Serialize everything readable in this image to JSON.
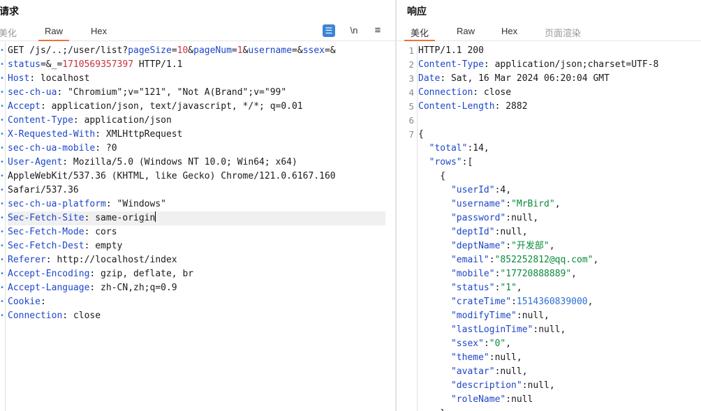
{
  "request": {
    "title": "请求",
    "tabs": {
      "pretty": "美化",
      "raw": "Raw",
      "hex": "Hex"
    },
    "icons": {
      "wrap": "wrap-lines-icon",
      "newline": "\\n",
      "menu": "≡"
    },
    "lines": [
      {
        "parts": [
          {
            "t": "GET /js/..;/user/list?"
          },
          {
            "t": "pageSize",
            "c": "p"
          },
          {
            "t": "="
          },
          {
            "t": "10",
            "c": "v"
          },
          {
            "t": "&"
          },
          {
            "t": "pageNum",
            "c": "p"
          },
          {
            "t": "="
          },
          {
            "t": "1",
            "c": "v"
          },
          {
            "t": "&"
          },
          {
            "t": "username",
            "c": "p"
          },
          {
            "t": "=&"
          },
          {
            "t": "ssex",
            "c": "p"
          },
          {
            "t": "=&"
          }
        ]
      },
      {
        "parts": [
          {
            "t": "status",
            "c": "p"
          },
          {
            "t": "=&_="
          },
          {
            "t": "1710569357397",
            "c": "v"
          },
          {
            "t": " HTTP/1.1"
          }
        ]
      },
      {
        "parts": [
          {
            "t": "Host",
            "c": "k"
          },
          {
            "t": ": localhost"
          }
        ]
      },
      {
        "parts": [
          {
            "t": "sec-ch-ua",
            "c": "k"
          },
          {
            "t": ": \"Chromium\";v=\"121\", \"Not A(Brand\";v=\"99\""
          }
        ]
      },
      {
        "parts": [
          {
            "t": "Accept",
            "c": "k"
          },
          {
            "t": ": application/json, text/javascript, */*; q=0.01"
          }
        ]
      },
      {
        "parts": [
          {
            "t": "Content-Type",
            "c": "k"
          },
          {
            "t": ": application/json"
          }
        ]
      },
      {
        "parts": [
          {
            "t": "X-Requested-With",
            "c": "k"
          },
          {
            "t": ": XMLHttpRequest"
          }
        ]
      },
      {
        "parts": [
          {
            "t": "sec-ch-ua-mobile",
            "c": "k"
          },
          {
            "t": ": ?0"
          }
        ]
      },
      {
        "parts": [
          {
            "t": "User-Agent",
            "c": "k"
          },
          {
            "t": ": Mozilla/5.0 (Windows NT 10.0; Win64; x64)"
          }
        ]
      },
      {
        "parts": [
          {
            "t": "AppleWebKit/537.36 (KHTML, like Gecko) Chrome/121.0.6167.160"
          }
        ]
      },
      {
        "parts": [
          {
            "t": "Safari/537.36"
          }
        ]
      },
      {
        "parts": [
          {
            "t": "sec-ch-ua-platform",
            "c": "k"
          },
          {
            "t": ": \"Windows\""
          }
        ]
      },
      {
        "parts": [
          {
            "t": "Sec-Fetch-Site",
            "c": "k"
          },
          {
            "t": ": same-origin"
          }
        ],
        "highlight": true,
        "caret": true
      },
      {
        "parts": [
          {
            "t": "Sec-Fetch-Mode",
            "c": "k"
          },
          {
            "t": ": cors"
          }
        ]
      },
      {
        "parts": [
          {
            "t": "Sec-Fetch-Dest",
            "c": "k"
          },
          {
            "t": ": empty"
          }
        ]
      },
      {
        "parts": [
          {
            "t": "Referer",
            "c": "k"
          },
          {
            "t": ": http://localhost/index"
          }
        ]
      },
      {
        "parts": [
          {
            "t": "Accept-Encoding",
            "c": "k"
          },
          {
            "t": ": gzip, deflate, br"
          }
        ]
      },
      {
        "parts": [
          {
            "t": "Accept-Language",
            "c": "k"
          },
          {
            "t": ": zh-CN,zh;q=0.9"
          }
        ]
      },
      {
        "parts": [
          {
            "t": "Cookie",
            "c": "k"
          },
          {
            "t": ":"
          }
        ]
      },
      {
        "parts": [
          {
            "t": "Connection",
            "c": "k"
          },
          {
            "t": ": close"
          }
        ]
      }
    ]
  },
  "response": {
    "title": "响应",
    "tabs": {
      "pretty": "美化",
      "raw": "Raw",
      "hex": "Hex",
      "render": "页面渲染"
    },
    "lines": [
      {
        "num": "1",
        "parts": [
          {
            "t": "HTTP/1.1 200"
          }
        ]
      },
      {
        "num": "2",
        "parts": [
          {
            "t": "Content-Type",
            "c": "k"
          },
          {
            "t": ": application/json;charset=UTF-8"
          }
        ]
      },
      {
        "num": "3",
        "parts": [
          {
            "t": "Date",
            "c": "k"
          },
          {
            "t": ": Sat, 16 Mar 2024 06:20:04 GMT"
          }
        ]
      },
      {
        "num": "4",
        "parts": [
          {
            "t": "Connection",
            "c": "k"
          },
          {
            "t": ": close"
          }
        ]
      },
      {
        "num": "5",
        "parts": [
          {
            "t": "Content-Length",
            "c": "k"
          },
          {
            "t": ": 2882"
          }
        ]
      },
      {
        "num": "6",
        "parts": []
      },
      {
        "num": "7",
        "parts": [
          {
            "t": "{"
          }
        ],
        "fold": true
      },
      {
        "num": "",
        "parts": [
          {
            "t": "  "
          },
          {
            "t": "\"total\"",
            "c": "jk"
          },
          {
            "t": ":14,"
          }
        ]
      },
      {
        "num": "",
        "parts": [
          {
            "t": "  "
          },
          {
            "t": "\"rows\"",
            "c": "jk"
          },
          {
            "t": ":["
          }
        ]
      },
      {
        "num": "",
        "parts": [
          {
            "t": "    {"
          }
        ]
      },
      {
        "num": "",
        "parts": [
          {
            "t": "      "
          },
          {
            "t": "\"userId\"",
            "c": "jk"
          },
          {
            "t": ":4,"
          }
        ]
      },
      {
        "num": "",
        "parts": [
          {
            "t": "      "
          },
          {
            "t": "\"username\"",
            "c": "jk"
          },
          {
            "t": ":"
          },
          {
            "t": "\"MrBird\"",
            "c": "js"
          },
          {
            "t": ","
          }
        ]
      },
      {
        "num": "",
        "parts": [
          {
            "t": "      "
          },
          {
            "t": "\"password\"",
            "c": "jk"
          },
          {
            "t": ":null,"
          }
        ]
      },
      {
        "num": "",
        "parts": [
          {
            "t": "      "
          },
          {
            "t": "\"deptId\"",
            "c": "jk"
          },
          {
            "t": ":null,"
          }
        ]
      },
      {
        "num": "",
        "parts": [
          {
            "t": "      "
          },
          {
            "t": "\"deptName\"",
            "c": "jk"
          },
          {
            "t": ":"
          },
          {
            "t": "\"开发部\"",
            "c": "js"
          },
          {
            "t": ","
          }
        ]
      },
      {
        "num": "",
        "parts": [
          {
            "t": "      "
          },
          {
            "t": "\"email\"",
            "c": "jk"
          },
          {
            "t": ":"
          },
          {
            "t": "\"852252812@qq.com\"",
            "c": "js"
          },
          {
            "t": ","
          }
        ]
      },
      {
        "num": "",
        "parts": [
          {
            "t": "      "
          },
          {
            "t": "\"mobile\"",
            "c": "jk"
          },
          {
            "t": ":"
          },
          {
            "t": "\"17720888889\"",
            "c": "js"
          },
          {
            "t": ","
          }
        ]
      },
      {
        "num": "",
        "parts": [
          {
            "t": "      "
          },
          {
            "t": "\"status\"",
            "c": "jk"
          },
          {
            "t": ":"
          },
          {
            "t": "\"1\"",
            "c": "js"
          },
          {
            "t": ","
          }
        ]
      },
      {
        "num": "",
        "parts": [
          {
            "t": "      "
          },
          {
            "t": "\"crateTime\"",
            "c": "jk"
          },
          {
            "t": ":"
          },
          {
            "t": "1514360839000",
            "c": "jn"
          },
          {
            "t": ","
          }
        ]
      },
      {
        "num": "",
        "parts": [
          {
            "t": "      "
          },
          {
            "t": "\"modifyTime\"",
            "c": "jk"
          },
          {
            "t": ":null,"
          }
        ]
      },
      {
        "num": "",
        "parts": [
          {
            "t": "      "
          },
          {
            "t": "\"lastLoginTime\"",
            "c": "jk"
          },
          {
            "t": ":null,"
          }
        ]
      },
      {
        "num": "",
        "parts": [
          {
            "t": "      "
          },
          {
            "t": "\"ssex\"",
            "c": "jk"
          },
          {
            "t": ":"
          },
          {
            "t": "\"0\"",
            "c": "js"
          },
          {
            "t": ","
          }
        ]
      },
      {
        "num": "",
        "parts": [
          {
            "t": "      "
          },
          {
            "t": "\"theme\"",
            "c": "jk"
          },
          {
            "t": ":null,"
          }
        ]
      },
      {
        "num": "",
        "parts": [
          {
            "t": "      "
          },
          {
            "t": "\"avatar\"",
            "c": "jk"
          },
          {
            "t": ":null,"
          }
        ]
      },
      {
        "num": "",
        "parts": [
          {
            "t": "      "
          },
          {
            "t": "\"description\"",
            "c": "jk"
          },
          {
            "t": ":null,"
          }
        ]
      },
      {
        "num": "",
        "parts": [
          {
            "t": "      "
          },
          {
            "t": "\"roleName\"",
            "c": "jk"
          },
          {
            "t": ":null"
          }
        ]
      },
      {
        "num": "",
        "parts": [
          {
            "t": "    },"
          }
        ]
      }
    ]
  }
}
